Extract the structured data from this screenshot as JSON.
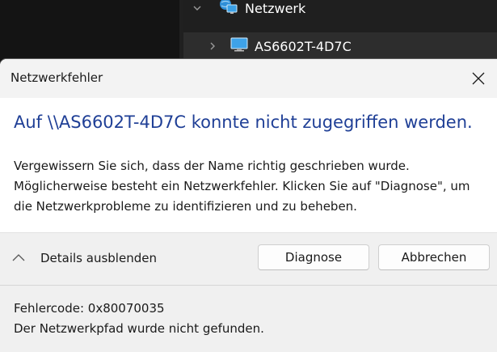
{
  "explorer": {
    "tree": {
      "network": {
        "label": "Netzwerk",
        "icon": "network-icon"
      },
      "host": {
        "label": "AS6602T-4D7C",
        "icon": "computer-icon"
      }
    }
  },
  "dialog": {
    "title": "Netzwerkfehler",
    "close_icon": "close-icon",
    "main_instruction": "Auf \\\\AS6602T-4D7C konnte nicht zugegriffen werden.",
    "content_lines": [
      "Vergewissern Sie sich, dass der Name richtig geschrieben wurde.",
      "Möglicherweise besteht ein Netzwerkfehler. Klicken Sie auf \"Diagnose\", um",
      "die Netzwerkprobleme zu identifizieren und zu beheben."
    ],
    "details_toggle": {
      "label": "Details ausblenden",
      "icon": "chevron-up-icon"
    },
    "buttons": {
      "diagnose": "Diagnose",
      "cancel": "Abbrechen"
    },
    "details": {
      "error_code": "Fehlercode: 0x80070035",
      "message": "Der Netzwerkpfad wurde nicht gefunden."
    }
  },
  "colors": {
    "main_instruction": "#1f3f96",
    "dialog_background": "#ffffff",
    "titlebar_background": "#f3f3f3",
    "footer_background": "#f0f0f0",
    "explorer_background": "#1f1f1f"
  }
}
